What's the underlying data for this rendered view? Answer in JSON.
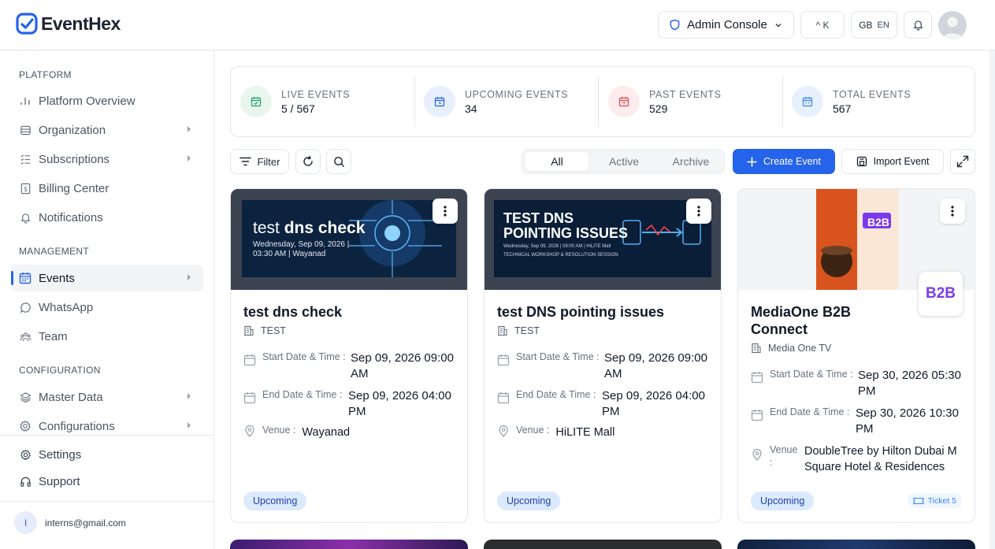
{
  "app": {
    "name": "EventHex"
  },
  "header": {
    "admin_console": "Admin Console",
    "shortcut": "^ K",
    "lang_flag": "GB",
    "lang_code": "EN"
  },
  "sidebar": {
    "sections": [
      {
        "label": "PLATFORM"
      },
      {
        "label": "MANAGEMENT"
      },
      {
        "label": "CONFIGURATION"
      }
    ],
    "items": [
      {
        "label": "Platform Overview"
      },
      {
        "label": "Organization"
      },
      {
        "label": "Subscriptions"
      },
      {
        "label": "Billing Center"
      },
      {
        "label": "Notifications"
      },
      {
        "label": "Events"
      },
      {
        "label": "WhatsApp"
      },
      {
        "label": "Team"
      },
      {
        "label": "Master Data"
      },
      {
        "label": "Configurations"
      },
      {
        "label": "Settings"
      },
      {
        "label": "Support"
      }
    ],
    "user": {
      "initial": "I",
      "email": "interns@gmail.com"
    }
  },
  "stats": [
    {
      "label": "LIVE EVENTS",
      "value": "5 / 567",
      "color": "#22a06b",
      "bg": "#e8f6ee"
    },
    {
      "label": "UPCOMING EVENTS",
      "value": "34",
      "color": "#2563eb",
      "bg": "#e7eefc"
    },
    {
      "label": "PAST EVENTS",
      "value": "529",
      "color": "#e5484d",
      "bg": "#fdecec"
    },
    {
      "label": "TOTAL EVENTS",
      "value": "567",
      "color": "#3b82f6",
      "bg": "#e6f1fd"
    }
  ],
  "toolbar": {
    "filter": "Filter",
    "tabs": [
      "All",
      "Active",
      "Archive"
    ],
    "create": "Create Event",
    "import": "Import Event"
  },
  "cards": [
    {
      "image_title_1": "test",
      "image_title_2": "dns check",
      "image_subtitle": "Wednesday, Sep 09, 2026 |",
      "image_subtitle_2": "03:30 AM | Wayanad",
      "title": "test dns check",
      "org": "TEST",
      "start_label": "Start Date & Time :",
      "start_value": "Sep 09, 2026 09:00 AM",
      "end_label": "End Date & Time :",
      "end_value": "Sep 09, 2026 04:00 PM",
      "venue_label": "Venue :",
      "venue_value": "Wayanad",
      "status": "Upcoming"
    },
    {
      "image_title_1": "TEST DNS",
      "image_title_2": "POINTING ISSUES",
      "image_subtitle": "Wednesday, Sep 09, 2026 | 09:00 AM | HiLITE Mall",
      "image_subtitle_2": "TECHNICAL WORKSHOP & RESOLUTION SESSION",
      "title": "test DNS pointing issues",
      "org": "TEST",
      "start_label": "Start Date & Time :",
      "start_value": "Sep 09, 2026 09:00 AM",
      "end_label": "End Date & Time :",
      "end_value": "Sep 09, 2026 04:00 PM",
      "venue_label": "Venue :",
      "venue_value": "HiLITE Mall",
      "status": "Upcoming"
    },
    {
      "title": "MediaOne B2B Connect",
      "org": "Media One TV",
      "start_label": "Start Date & Time :",
      "start_value": "Sep 30, 2026 05:30 PM",
      "end_label": "End Date & Time :",
      "end_value": "Sep 30, 2026 10:30 PM",
      "venue_label": "Venue :",
      "venue_value": "DoubleTree by Hilton Dubai M Square Hotel & Residences",
      "status": "Upcoming",
      "ticket": "Ticket 5",
      "poster_text": "B2B"
    }
  ]
}
